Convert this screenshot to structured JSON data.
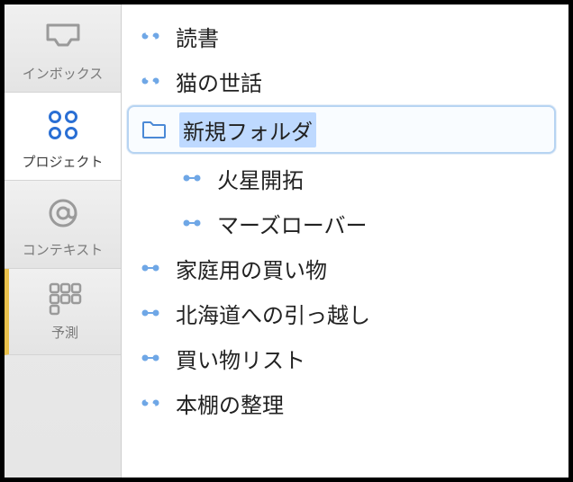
{
  "sidebar": {
    "tabs": [
      {
        "id": "inbox",
        "label": "インボックス",
        "active": false
      },
      {
        "id": "projects",
        "label": "プロジェクト",
        "active": true
      },
      {
        "id": "contexts",
        "label": "コンテキスト",
        "active": false
      },
      {
        "id": "forecast",
        "label": "予測",
        "active": false
      }
    ]
  },
  "colors": {
    "accent_blue": "#2a6fd4",
    "selection_bg": "#bed9ff",
    "folder_stroke": "#4b89d6",
    "forecast_accent": "#e9c04b"
  },
  "projects": {
    "items": [
      {
        "kind": "single",
        "label": "読書",
        "indent": 0,
        "selected": false
      },
      {
        "kind": "single",
        "label": "猫の世話",
        "indent": 0,
        "selected": false
      },
      {
        "kind": "folder",
        "label": "新規フォルダ",
        "indent": 0,
        "selected": true,
        "editing": true
      },
      {
        "kind": "parallel",
        "label": "火星開拓",
        "indent": 1,
        "selected": false
      },
      {
        "kind": "parallel",
        "label": "マーズローバー",
        "indent": 1,
        "selected": false
      },
      {
        "kind": "parallel",
        "label": "家庭用の買い物",
        "indent": 0,
        "selected": false
      },
      {
        "kind": "parallel",
        "label": "北海道への引っ越し",
        "indent": 0,
        "selected": false
      },
      {
        "kind": "parallel",
        "label": "買い物リスト",
        "indent": 0,
        "selected": false
      },
      {
        "kind": "single",
        "label": "本棚の整理",
        "indent": 0,
        "selected": false
      }
    ]
  }
}
